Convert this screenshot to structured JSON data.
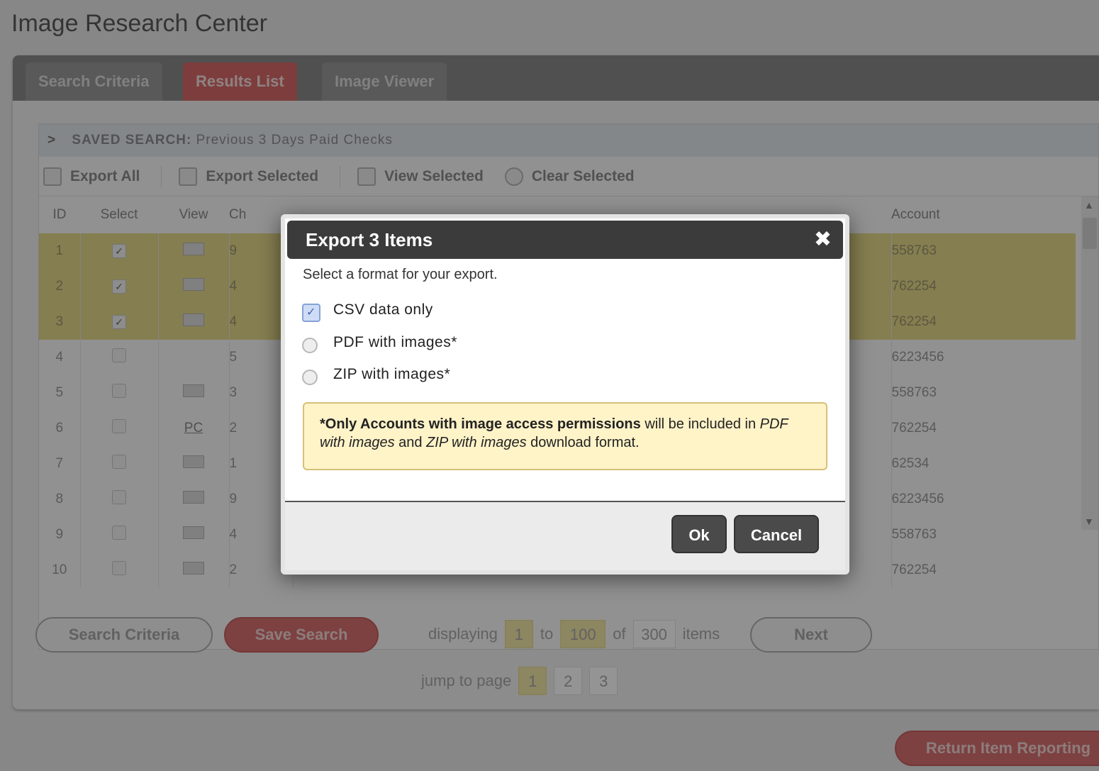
{
  "app": {
    "title": "Image Research Center"
  },
  "tabs": [
    {
      "label": "Search Criteria",
      "active": false
    },
    {
      "label": "Results List",
      "active": true
    },
    {
      "label": "Image Viewer",
      "active": false
    }
  ],
  "saved_search": {
    "label": "SAVED SEARCH:",
    "name": "Previous 3 Days Paid Checks"
  },
  "toolbar": {
    "export_all": "Export All",
    "export_selected": "Export Selected",
    "view_selected": "View Selected",
    "clear_selected": "Clear Selected"
  },
  "table": {
    "columns": [
      "ID",
      "Select",
      "View",
      "Ch",
      "Account"
    ],
    "rows": [
      {
        "id": "1",
        "selected": true,
        "view": "icon",
        "ch": "9",
        "account": "558763"
      },
      {
        "id": "2",
        "selected": true,
        "view": "icon",
        "ch": "4",
        "account": "762254"
      },
      {
        "id": "3",
        "selected": true,
        "view": "icon",
        "ch": "4",
        "account": "762254"
      },
      {
        "id": "4",
        "selected": false,
        "view": "",
        "ch": "5",
        "account": "6223456"
      },
      {
        "id": "5",
        "selected": false,
        "view": "icon",
        "ch": "3",
        "account": "558763"
      },
      {
        "id": "6",
        "selected": false,
        "view": "PC",
        "ch": "2",
        "account": "762254"
      },
      {
        "id": "7",
        "selected": false,
        "view": "icon",
        "ch": "1",
        "account": "62534"
      },
      {
        "id": "8",
        "selected": false,
        "view": "icon",
        "ch": "9",
        "account": "6223456"
      },
      {
        "id": "9",
        "selected": false,
        "view": "icon",
        "ch": "4",
        "account": "558763"
      },
      {
        "id": "10",
        "selected": false,
        "view": "icon",
        "ch": "2",
        "account": "762254"
      }
    ]
  },
  "footer": {
    "search_criteria": "Search Criteria",
    "save_search": "Save Search",
    "displaying": "displaying",
    "from": "1",
    "to_label": "to",
    "to": "100",
    "of_label": "of",
    "total": "300",
    "items": "items",
    "next": "Next",
    "jump_label": "jump to page",
    "pages": [
      "1",
      "2",
      "3"
    ],
    "return_label": "Return Item Reporting"
  },
  "dialog": {
    "title": "Export 3 Items",
    "close_glyph": "✖",
    "prompt": "Select a format for your export.",
    "options": [
      {
        "label": "CSV data only",
        "checked": true
      },
      {
        "label": "PDF with images*",
        "checked": false
      },
      {
        "label": "ZIP with images*",
        "checked": false
      }
    ],
    "notice": {
      "part1": "*Only Accounts with image access permissions",
      "part2": " will be included in ",
      "part3": "PDF with images",
      "part4": " and ",
      "part5": "ZIP with images",
      "part6": " download format."
    },
    "ok": "Ok",
    "cancel": "Cancel"
  }
}
